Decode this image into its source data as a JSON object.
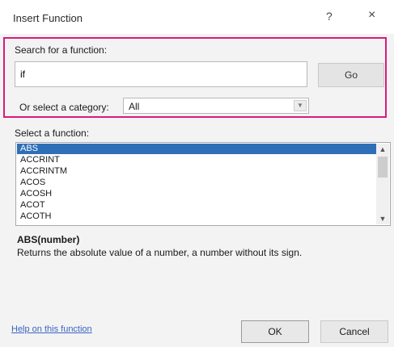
{
  "dialog": {
    "title": "Insert Function",
    "help_glyph": "?",
    "close_glyph": "×",
    "highlight_color": "#d81b7a"
  },
  "search": {
    "label": "Search for a function:",
    "value": "if",
    "go_label": "Go"
  },
  "category": {
    "label": "Or select a category:",
    "selected": "All"
  },
  "function_list": {
    "label": "Select a function:",
    "items": [
      "ABS",
      "ACCRINT",
      "ACCRINTM",
      "ACOS",
      "ACOSH",
      "ACOT",
      "ACOTH"
    ],
    "selected_index": 0,
    "selection_color": "#2f6fb8"
  },
  "details": {
    "syntax": "ABS(number)",
    "description": "Returns the absolute value of a number, a number without its sign."
  },
  "footer": {
    "help_link": "Help on this function",
    "ok_label": "OK",
    "cancel_label": "Cancel"
  }
}
